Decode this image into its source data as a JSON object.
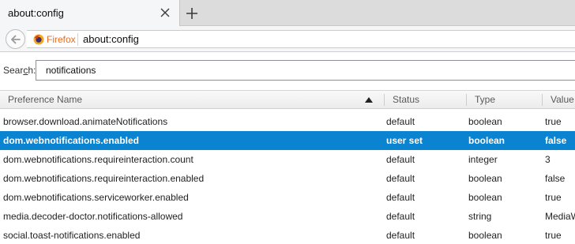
{
  "tab": {
    "title": "about:config"
  },
  "navbar": {
    "identity_label": "Firefox",
    "url": "about:config"
  },
  "search": {
    "label_prefix": "Sear",
    "label_accesskey": "c",
    "label_suffix": "h:",
    "value": "notifications"
  },
  "columns": {
    "name": "Preference Name",
    "status": "Status",
    "type": "Type",
    "value": "Value"
  },
  "rows": [
    {
      "name": "browser.download.animateNotifications",
      "status": "default",
      "type": "boolean",
      "value": "true"
    },
    {
      "name": "dom.webnotifications.enabled",
      "status": "user set",
      "type": "boolean",
      "value": "false"
    },
    {
      "name": "dom.webnotifications.requireinteraction.count",
      "status": "default",
      "type": "integer",
      "value": "3"
    },
    {
      "name": "dom.webnotifications.requireinteraction.enabled",
      "status": "default",
      "type": "boolean",
      "value": "false"
    },
    {
      "name": "dom.webnotifications.serviceworker.enabled",
      "status": "default",
      "type": "boolean",
      "value": "true"
    },
    {
      "name": "media.decoder-doctor.notifications-allowed",
      "status": "default",
      "type": "string",
      "value": "MediaW"
    },
    {
      "name": "social.toast-notifications.enabled",
      "status": "default",
      "type": "boolean",
      "value": "true"
    }
  ],
  "selected_row": 1,
  "colors": {
    "selection": "#0a84d0",
    "firefox_orange": "#e86e21"
  },
  "icons": [
    "close-icon",
    "plus-icon",
    "back-arrow-icon",
    "firefox-logo-icon",
    "sort-ascending-icon"
  ]
}
